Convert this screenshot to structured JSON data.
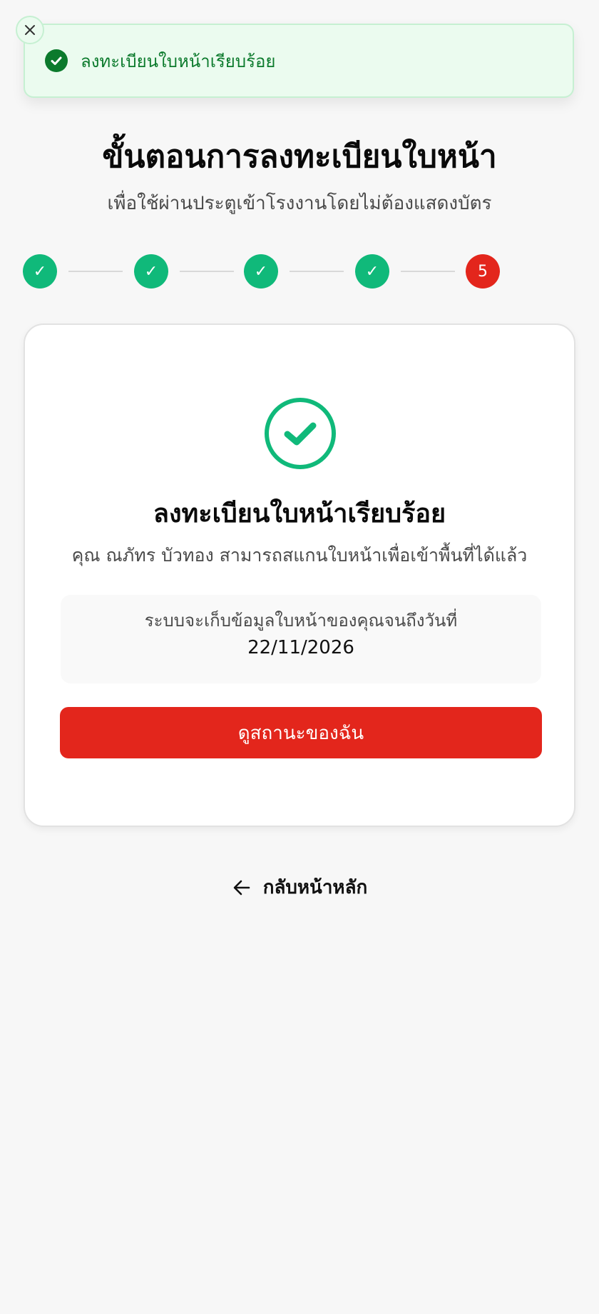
{
  "toast": {
    "message": "ลงทะเบียนใบหน้าเรียบร้อย",
    "close_icon": "close-icon",
    "check_icon": "check-circle-icon",
    "color": "#0b7a2c"
  },
  "header": {
    "title": "ขั้นตอนการลงทะเบียนใบหน้า",
    "subtitle": "เพื่อใช้ผ่านประตูเข้าโรงงานโดยไม่ต้องแสดงบัตร"
  },
  "stepper": {
    "steps": [
      {
        "label": "✓",
        "status": "done"
      },
      {
        "label": "✓",
        "status": "done"
      },
      {
        "label": "✓",
        "status": "done"
      },
      {
        "label": "✓",
        "status": "done"
      },
      {
        "label": "5",
        "status": "current"
      }
    ],
    "done_color": "#10b97a",
    "current_color": "#e3261c"
  },
  "card": {
    "success_icon": "check-circle-icon",
    "title": "ลงทะเบียนใบหน้าเรียบร้อย",
    "description": "คุณ ณภัทร บัวทอง สามารถสแกนใบหน้าเพื่อเข้าพื้นที่ได้แล้ว",
    "info_text": "ระบบจะเก็บข้อมูลใบหน้าของคุณจนถึงวันที่",
    "info_date": "22/11/2026",
    "button_label": "ดูสถานะของฉัน",
    "button_color": "#e3261c"
  },
  "footer": {
    "back_label": "กลับหน้าหลัก",
    "back_icon": "arrow-left-icon"
  }
}
